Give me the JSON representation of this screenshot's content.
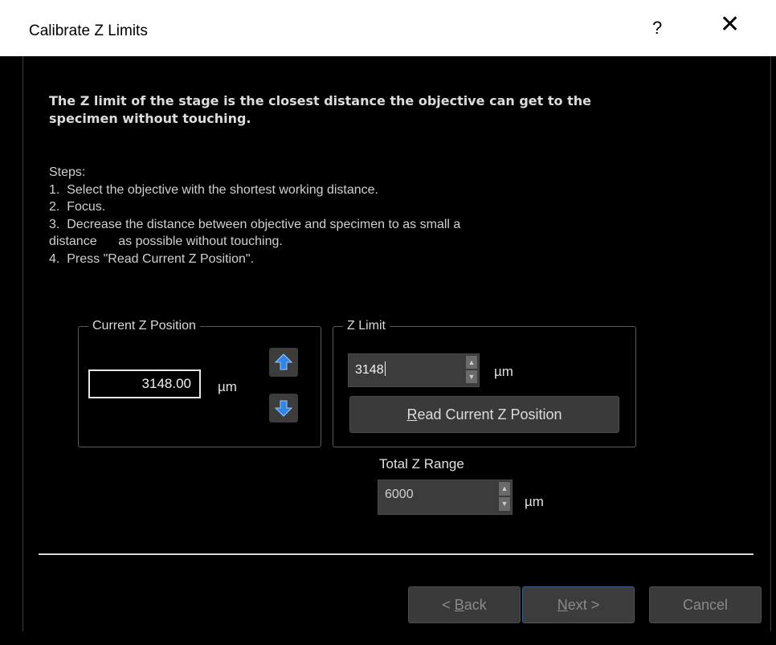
{
  "window": {
    "title": "Calibrate Z Limits",
    "help_label": "?",
    "close_label": "✕"
  },
  "intro": "The Z limit of the stage is the closest distance the objective can get to the specimen without touching.",
  "steps": {
    "heading": "Steps:",
    "items": [
      "1.  Select the objective with the shortest working distance.",
      "2.  Focus.",
      "3.  Decrease the distance between objective and specimen to as small a",
      "distance      as possible without touching.",
      "4.  Press \"Read Current Z Position\"."
    ]
  },
  "current_z": {
    "legend": "Current Z Position",
    "value": "3148.00",
    "unit": "µm",
    "up_icon": "arrow-up-icon",
    "down_icon": "arrow-down-icon"
  },
  "z_limit": {
    "legend": "Z Limit",
    "value": "3148",
    "unit": "µm",
    "read_button": {
      "mnemonic": "R",
      "rest": "ead Current Z Position"
    }
  },
  "total_range": {
    "label": "Total Z Range",
    "value": "6000",
    "unit": "µm"
  },
  "buttons": {
    "back": {
      "prefix": "< ",
      "mnemonic": "B",
      "rest": "ack"
    },
    "next": {
      "mnemonic": "N",
      "rest": "ext >"
    },
    "cancel": "Cancel"
  },
  "colors": {
    "background": "#000000",
    "titlebar": "#ffffff",
    "button": "#3a3a3a",
    "arrow_icon": "#2f86e6",
    "next_border": "#3a5a8a"
  }
}
